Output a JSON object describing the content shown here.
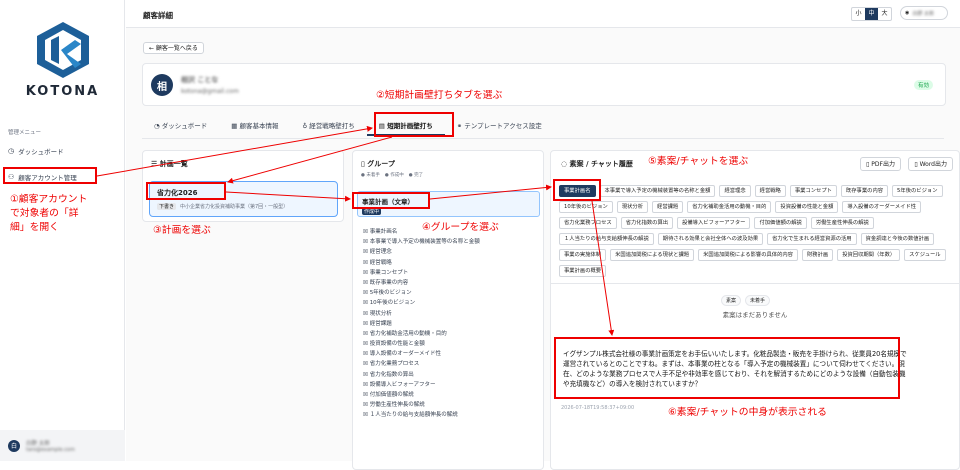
{
  "app": {
    "logo_text": "KOTONA"
  },
  "sidebar": {
    "section": "管理メニュー",
    "items": [
      {
        "label": "ダッシュボード",
        "icon": "dashboard-icon"
      },
      {
        "label": "顧客アカウント管理",
        "icon": "users-icon"
      }
    ],
    "user": {
      "avatar": "白",
      "name": "白野 太郎",
      "email": "taro@example.com"
    }
  },
  "header": {
    "title": "顧客詳細",
    "sizes": [
      "小",
      "中",
      "大"
    ],
    "active_size": "中",
    "user": "白野 太郎"
  },
  "back": "← 顧客一覧へ戻る",
  "customer": {
    "avatar": "相",
    "name": "相沢 ことな",
    "email": "kotona@gmail.com",
    "status": "有効"
  },
  "tabs": [
    "ダッシュボード",
    "顧客基本情報",
    "経営戦略壁打ち",
    "短期計画壁打ち",
    "テンプレートアクセス設定"
  ],
  "plans": {
    "title": "計画一覧",
    "item": {
      "name": "省力化2026",
      "tag": "下書き",
      "desc": "中小企業省力化投資補助事業（第7回・一般型）"
    }
  },
  "groups": {
    "title": "グループ",
    "legend": [
      "未着手",
      "作成中",
      "完了"
    ],
    "selected": {
      "name": "事業計画（文章）",
      "tag": "作成中"
    },
    "items": [
      "事業計画名",
      "本事業で導入予定の機械装置等の名称と金額",
      "経営理念",
      "経営戦略",
      "事業コンセプト",
      "既存事業の内容",
      "5年後のビジョン",
      "10年後のビジョン",
      "現状分析",
      "経営課題",
      "省力化補助金活用の動機・目的",
      "投資設備の性能と金額",
      "導入設備のオーダーメイド性",
      "省力化業務プロセス",
      "省力化指数の算出",
      "設備導入ビフォーアフター",
      "付加価値額の解説",
      "労働生産性伸長の解説",
      "１人当たりの給与支給額伸長の解説"
    ]
  },
  "chat": {
    "title": "素案 / チャット履歴",
    "pdf": "PDF出力",
    "word": "Word出力",
    "chips": [
      "事業計画名",
      "本事業で導入予定の機械装置等の名称と金額",
      "経営理念",
      "経営戦略",
      "事業コンセプト",
      "既存事業の内容",
      "5年後のビジョン",
      "10年後のビジョン",
      "現状分析",
      "経営課題",
      "省力化補助金活用の動機・目的",
      "投資設備の性能と金額",
      "導入設備のオーダーメイド性",
      "省力化業務プロセス",
      "省力化指数の算出",
      "設備導入ビフォーアフター",
      "付加価値額の解説",
      "労働生産性伸長の解説",
      "１人当たりの給与支給額伸長の解説",
      "期待される効果と会社全体への波及効果",
      "省力化で生まれる経営資源の活用",
      "資金調達と今後の数値計画",
      "事業の実施体制",
      "米国追加関税による現状と課題",
      "米国追加関税による影響の具体的内容",
      "財務計画",
      "投資回収期間（年数）",
      "スケジュール",
      "事業計画の概要"
    ],
    "status": [
      "素案",
      "未着手"
    ],
    "empty": "素案はまだありません",
    "response": "イグザンプル株式会社様の事業計画策定をお手伝いいたします。化粧品製造・販売を手掛けられ、従業員20名規模で運営されているとのことですね。まずは、本事業の柱となる「導入予定の機械装置」について伺わせてください。現在、どのような業務プロセスで人手不足や非効率を感じており、それを解消するためにどのような設備（自動包装機や充填機など）の導入を検討されていますか？",
    "timestamp": "2026-07-18T19:58:37+09:00"
  },
  "annotations": {
    "step1": [
      "①顧客アカウント",
      "で対象者の「詳",
      "細」を開く"
    ],
    "step2": "②短期計画壁打ちタブを選ぶ",
    "step3": "③計画を選ぶ",
    "step4": "④グループを選ぶ",
    "step5": "⑤素案/チャットを選ぶ",
    "step6": "⑥素案/チャットの中身が表示される",
    "color": "#ee0000"
  }
}
